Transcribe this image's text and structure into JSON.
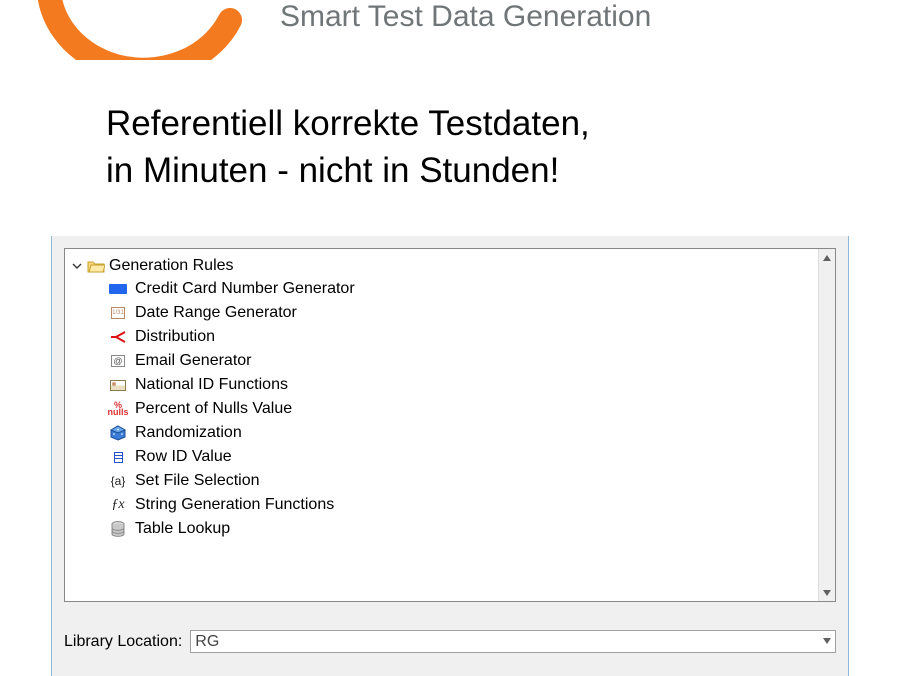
{
  "header": {
    "subtitle": "Smart Test Data Generation",
    "headline_line1": "Referentiell korrekte Testdaten,",
    "headline_line2": "in Minuten - nicht in Stunden!"
  },
  "tree": {
    "root_label": "Generation Rules",
    "items": [
      {
        "label": "Credit Card Number Generator",
        "icon": "credit-card-icon"
      },
      {
        "label": "Date Range Generator",
        "icon": "calendar-icon"
      },
      {
        "label": "Distribution",
        "icon": "distribution-icon"
      },
      {
        "label": "Email Generator",
        "icon": "email-icon"
      },
      {
        "label": "National ID Functions",
        "icon": "id-card-icon"
      },
      {
        "label": "Percent of Nulls Value",
        "icon": "percent-nulls-icon"
      },
      {
        "label": "Randomization",
        "icon": "dice-icon"
      },
      {
        "label": "Row ID Value",
        "icon": "row-id-icon"
      },
      {
        "label": "Set File Selection",
        "icon": "set-brace-icon"
      },
      {
        "label": "String Generation Functions",
        "icon": "fx-icon"
      },
      {
        "label": "Table Lookup",
        "icon": "database-icon"
      }
    ]
  },
  "library": {
    "label": "Library Location:",
    "selected": "RG"
  },
  "icon_text": {
    "date": "1/31",
    "nulls_top": "%",
    "nulls_bot": "nulls",
    "set": "{a}",
    "fx": "ƒx",
    "email": "@"
  }
}
